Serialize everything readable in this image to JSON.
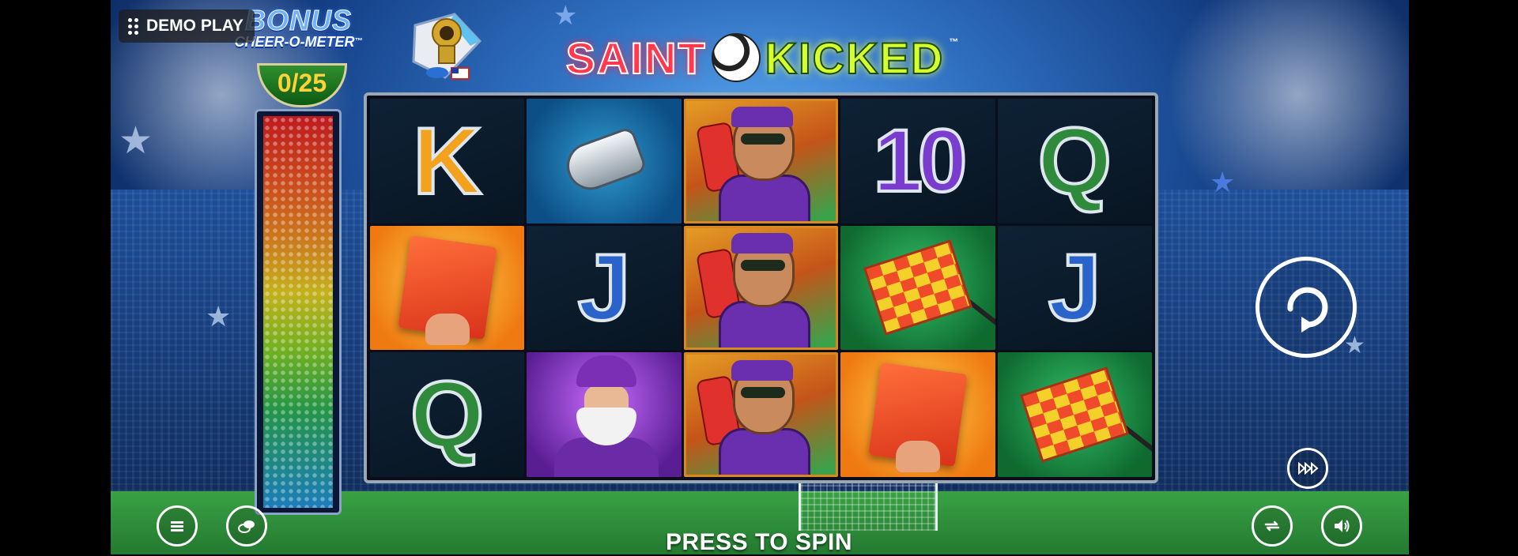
{
  "demo_label": "DEMO PLAY",
  "bonus_meter": {
    "title_line1": "BONUS",
    "title_line2": "CHEER-O-METER",
    "tm": "™",
    "count": "0/25",
    "progress": 0
  },
  "logo": {
    "part1": "SAINT",
    "part2": "KICKED",
    "tm": "™"
  },
  "reels": [
    [
      {
        "symbol": "K",
        "type": "letter-k"
      },
      {
        "symbol": "red-card",
        "type": "card"
      },
      {
        "symbol": "Q",
        "type": "letter-q"
      }
    ],
    [
      {
        "symbol": "whistle",
        "type": "whistle"
      },
      {
        "symbol": "J",
        "type": "letter-j"
      },
      {
        "symbol": "santa-fan",
        "type": "santa"
      }
    ],
    [
      {
        "symbol": "reindeer-fan",
        "type": "fan"
      },
      {
        "symbol": "reindeer-fan",
        "type": "fan"
      },
      {
        "symbol": "reindeer-fan",
        "type": "fan"
      }
    ],
    [
      {
        "symbol": "10",
        "type": "letter-10"
      },
      {
        "symbol": "corner-flag",
        "type": "flag"
      },
      {
        "symbol": "red-card",
        "type": "card"
      }
    ],
    [
      {
        "symbol": "Q",
        "type": "letter-q"
      },
      {
        "symbol": "J",
        "type": "letter-j"
      },
      {
        "symbol": "corner-flag",
        "type": "flag"
      }
    ]
  ],
  "controls": {
    "press_to_spin": "PRESS TO SPIN",
    "spin_icon": "refresh-icon",
    "turbo_icon": "fast-forward-icon",
    "menu_icon": "menu-icon",
    "bet_icon": "coins-icon",
    "autoplay_icon": "autoplay-icon",
    "sound_icon": "speaker-icon"
  },
  "colors": {
    "saint": "#ff3a4f",
    "kicked": "#d6ff2e",
    "counter": "#ffd23a"
  }
}
